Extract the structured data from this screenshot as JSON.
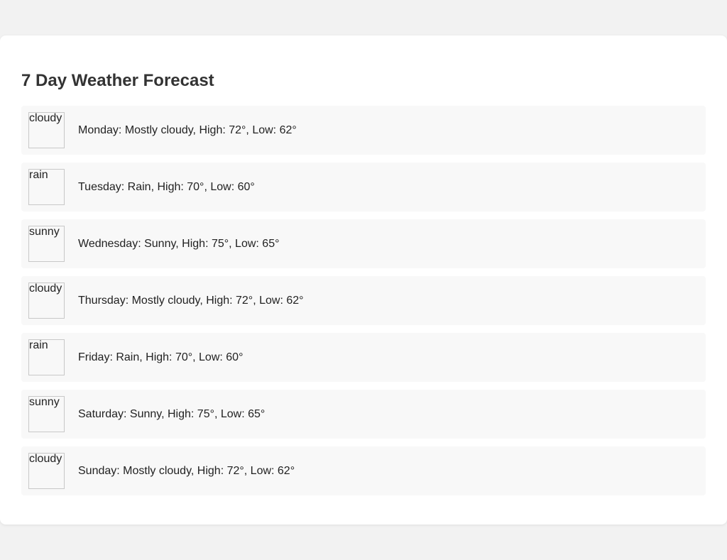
{
  "page": {
    "title": "7 Day Weather Forecast"
  },
  "forecast": [
    {
      "icon_alt": "cloudy",
      "text": "Monday: Mostly cloudy, High: 72°, Low: 62°"
    },
    {
      "icon_alt": "rain",
      "text": "Tuesday: Rain, High: 70°, Low: 60°"
    },
    {
      "icon_alt": "sunny",
      "text": "Wednesday: Sunny, High: 75°, Low: 65°"
    },
    {
      "icon_alt": "cloudy",
      "text": "Thursday: Mostly cloudy, High: 72°, Low: 62°"
    },
    {
      "icon_alt": "rain",
      "text": "Friday: Rain, High: 70°, Low: 60°"
    },
    {
      "icon_alt": "sunny",
      "text": "Saturday: Sunny, High: 75°, Low: 65°"
    },
    {
      "icon_alt": "cloudy",
      "text": "Sunday: Mostly cloudy, High: 72°, Low: 62°"
    }
  ],
  "colors": {
    "page_background": "#f2f2f2",
    "card_background": "#ffffff",
    "row_background": "#f8f8f8",
    "title_text": "#333333"
  }
}
